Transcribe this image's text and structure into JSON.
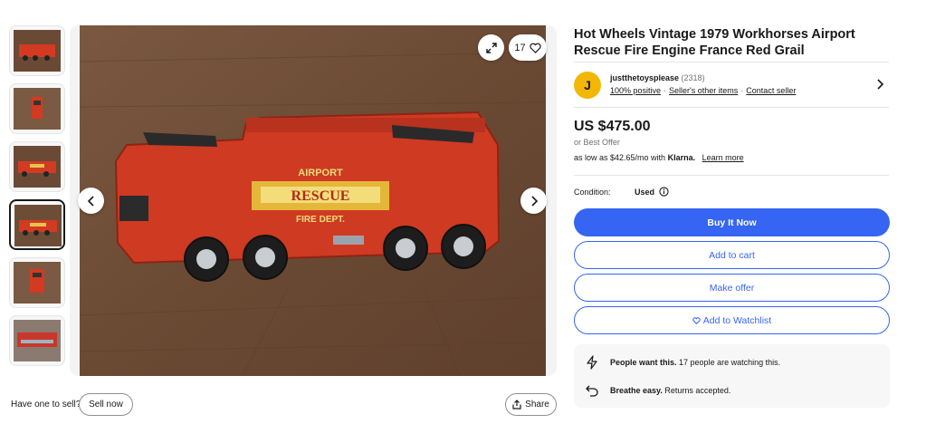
{
  "thumbnails": [
    {
      "label": "thumbnail 1",
      "selected": false
    },
    {
      "label": "thumbnail 2",
      "selected": false
    },
    {
      "label": "thumbnail 3",
      "selected": false
    },
    {
      "label": "thumbnail 4",
      "selected": true
    },
    {
      "label": "thumbnail 5",
      "selected": false
    },
    {
      "label": "thumbnail 6",
      "selected": false
    }
  ],
  "viewer": {
    "watch_count": "17",
    "icons": {
      "expand": "expand-icon",
      "heart": "heart-icon",
      "prev": "chevron-left-icon",
      "next": "chevron-right-icon"
    }
  },
  "sell": {
    "question": "Have one to sell?",
    "button": "Sell now"
  },
  "share": {
    "label": "Share",
    "icon": "share-icon"
  },
  "listing": {
    "title": "Hot Wheels Vintage 1979 Workhorses Airport Rescue Fire Engine France Red Grail",
    "price": "US $475.00",
    "best_offer": "or Best Offer",
    "klarna_prefix": "as low as $42.65/mo with",
    "klarna_brand": "Klarna.",
    "klarna_link": "Learn more",
    "condition_label": "Condition:",
    "condition_value": "Used"
  },
  "seller": {
    "initial": "J",
    "name": "justthetoysplease",
    "feedback_count": "(2318)",
    "positive": "100% positive",
    "other_items": "Seller's other items",
    "contact": "Contact seller",
    "avatar_color": "#f2b705"
  },
  "actions": {
    "buy_now": "Buy It Now",
    "add_to_cart": "Add to cart",
    "make_offer": "Make offer",
    "watchlist": "Add to Watchlist"
  },
  "info": {
    "want_bold": "People want this.",
    "want_text": "17 people are watching this.",
    "breathe_bold": "Breathe easy.",
    "breathe_text": "Returns accepted."
  },
  "colors": {
    "accent": "#3665f3",
    "text": "#191919",
    "muted": "#707070",
    "panel": "#f7f7f7"
  }
}
